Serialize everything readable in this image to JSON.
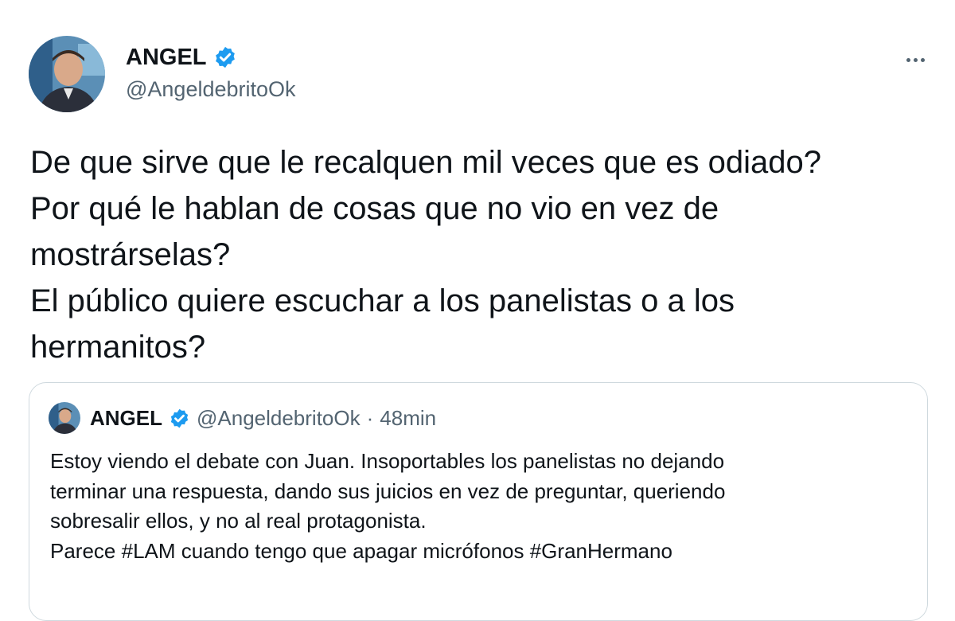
{
  "tweet": {
    "author": {
      "name": "ANGEL",
      "handle": "@AngeldebritoOk",
      "verified": true
    },
    "text_lines": [
      "De que sirve que le recalquen mil veces que es odiado?",
      "Por qué le hablan de cosas que no vio en vez de",
      "mostrárselas?",
      "El público quiere escuchar a los panelistas o a los",
      "hermanitos?"
    ],
    "menu_icon": "more-horizontal-icon"
  },
  "quoted_tweet": {
    "author": {
      "name": "ANGEL",
      "handle": "@AngeldebritoOk",
      "verified": true
    },
    "separator": "·",
    "time": "48min",
    "text_lines": [
      "Estoy viendo el debate con Juan. Insoportables los panelistas no dejando",
      "terminar una respuesta, dando sus juicios en vez de preguntar, queriendo",
      "sobresalir ellos, y no al real protagonista.",
      "Parece #LAM cuando tengo que apagar micrófonos #GranHermano"
    ]
  },
  "colors": {
    "text": "#0f1419",
    "secondary": "#536471",
    "verified": "#1d9bf0",
    "border": "#cfd9de"
  }
}
